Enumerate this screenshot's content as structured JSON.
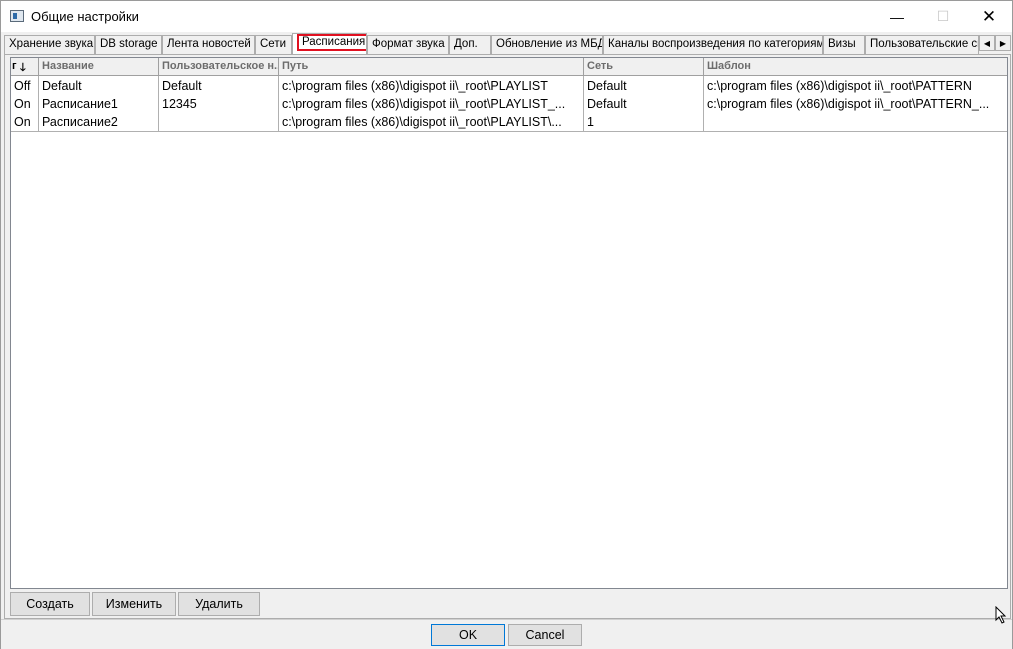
{
  "window": {
    "title": "Общие настройки",
    "minimize": "—",
    "maximize": "☐",
    "close": "✕"
  },
  "tabs": [
    {
      "label": "Хранение звука"
    },
    {
      "label": "DB storage"
    },
    {
      "label": "Лента новостей"
    },
    {
      "label": "Сети"
    },
    {
      "label": "Расписания",
      "active": true
    },
    {
      "label": "Формат звука"
    },
    {
      "label": "Доп."
    },
    {
      "label": "Обновление из МБД"
    },
    {
      "label": "Каналы воспроизведения по категориям"
    },
    {
      "label": "Визы"
    },
    {
      "label": "Пользовательские св..."
    }
  ],
  "tab_scroll": {
    "left": "◀",
    "right": "▶"
  },
  "table": {
    "sort_marker": "г",
    "sort_icon": "🡓",
    "columns": [
      "Название",
      "Пользовательское н...",
      "Путь",
      "Сеть",
      "Шаблон"
    ],
    "rows": [
      {
        "state": "Off",
        "name": "Default",
        "custom": "Default",
        "path": "c:\\program files (x86)\\digispot ii\\_root\\PLAYLIST",
        "net": "Default",
        "template": "c:\\program files (x86)\\digispot ii\\_root\\PATTERN"
      },
      {
        "state": "On",
        "name": "Расписание1",
        "custom": "12345",
        "path": "c:\\program files (x86)\\digispot ii\\_root\\PLAYLIST_...",
        "net": "Default",
        "template": "c:\\program files (x86)\\digispot ii\\_root\\PATTERN_..."
      },
      {
        "state": "On",
        "name": "Расписание2",
        "custom": "",
        "path": "c:\\program files (x86)\\digispot ii\\_root\\PLAYLIST\\...",
        "net": "1",
        "template": ""
      }
    ]
  },
  "actions": {
    "create": "Создать",
    "edit": "Изменить",
    "delete": "Удалить"
  },
  "dialog": {
    "ok": "OK",
    "cancel": "Cancel"
  },
  "icons": {
    "app": "settings-window-icon",
    "sort": "sort-down-arrow-icon"
  }
}
